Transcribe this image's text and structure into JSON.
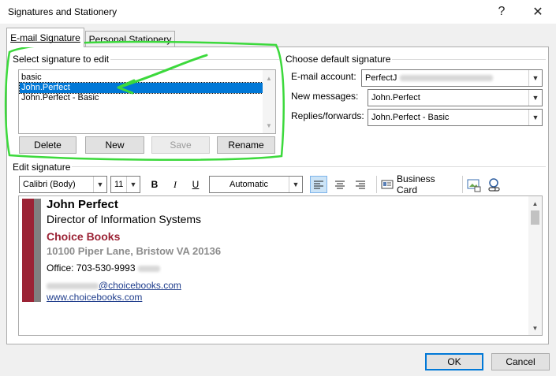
{
  "window": {
    "title": "Signatures and Stationery",
    "help_glyph": "?",
    "close_glyph": "✕"
  },
  "tabs": [
    {
      "label": "E-mail Signature",
      "active": true
    },
    {
      "label": "Personal Stationery",
      "active": false
    }
  ],
  "select_signature": {
    "group_label": "Select signature to edit",
    "items": [
      "basic",
      "John.Perfect",
      "John.Perfect - Basic"
    ],
    "selected_index": 1,
    "buttons": {
      "delete": "Delete",
      "new": "New",
      "save": "Save",
      "rename": "Rename"
    }
  },
  "default_signature": {
    "group_label": "Choose default signature",
    "email_account_label": "E-mail account:",
    "email_account_value": "PerfectJ",
    "new_messages_label": "New messages:",
    "new_messages_value": "John.Perfect",
    "replies_label": "Replies/forwards:",
    "replies_value": "John.Perfect - Basic"
  },
  "edit_signature": {
    "group_label": "Edit signature",
    "font_value": "Calibri (Body)",
    "size_value": "11",
    "bold": "B",
    "italic": "I",
    "underline": "U",
    "color_value": "Automatic",
    "business_card_label": "Business Card"
  },
  "signature_content": {
    "name": "John Perfect",
    "position": "Director of Information Systems",
    "company": "Choice Books",
    "address": "10100 Piper Lane, Bristow VA 20136",
    "office": "Office: 703-530-9993",
    "email_domain": "@choicebooks.com",
    "website": "www.choicebooks.com",
    "accent_bar_color": "#9b2335",
    "side_bar_color": "#808080",
    "company_color": "#9b2335",
    "address_color": "#8c8c8c",
    "link_color": "#1f3d8c"
  },
  "footer": {
    "ok": "OK",
    "cancel": "Cancel"
  },
  "annotation": {
    "stroke_color": "#3cd93c"
  }
}
